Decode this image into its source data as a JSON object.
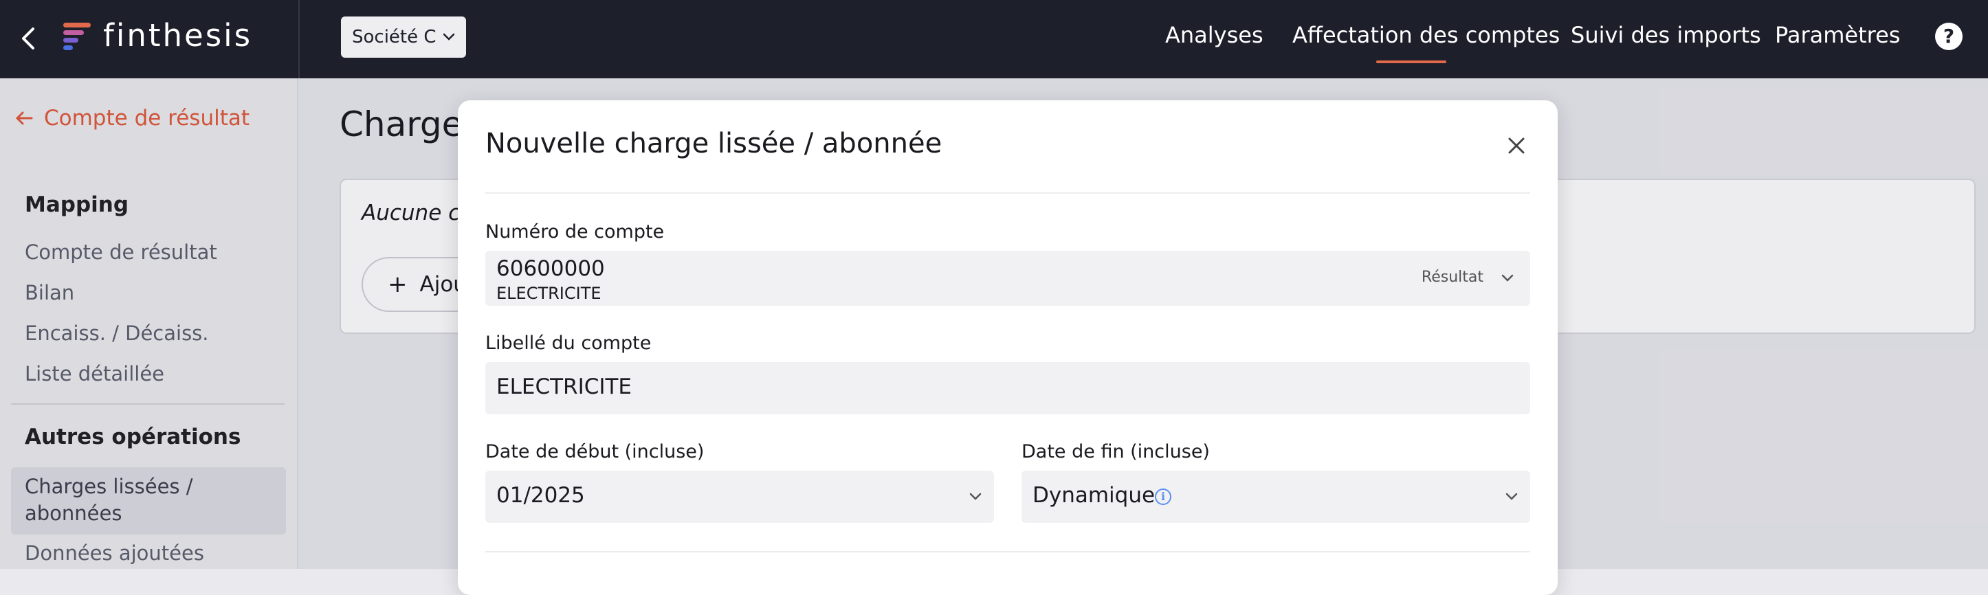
{
  "app": {
    "logo_text": "finthesis"
  },
  "header": {
    "company_select": {
      "value": "Société C"
    },
    "nav": [
      "Analyses",
      "Affectation des comptes",
      "Suivi des imports",
      "Paramètres"
    ],
    "active_nav": "Affectation des comptes",
    "help_label": "?"
  },
  "sidebar": {
    "back_label": "Compte de résultat",
    "sections": [
      {
        "heading": "Mapping",
        "items": [
          "Compte de résultat",
          "Bilan",
          "Encaiss. / Décaiss.",
          "Liste détaillée"
        ]
      },
      {
        "heading": "Autres opérations",
        "items": [
          "Charges lissées / abonnées",
          "Données ajoutées"
        ]
      }
    ],
    "active_item": "Charges lissées / abonnées"
  },
  "main": {
    "title": "Charges",
    "empty_text": "Aucune ch",
    "add_button_label": "Ajou"
  },
  "modal": {
    "title": "Nouvelle charge lissée / abonnée",
    "account_number": {
      "label": "Numéro de compte",
      "value": "60600000",
      "sub_value": "ELECTRICITE",
      "type": "Résultat"
    },
    "account_label": {
      "label": "Libellé du compte",
      "value": "ELECTRICITE"
    },
    "start_date": {
      "label": "Date de début (incluse)",
      "value": "01/2025"
    },
    "end_date": {
      "label": "Date de fin (incluse)",
      "value": "Dynamique",
      "info_icon": "i"
    }
  },
  "colors": {
    "topbar": "#1d1f2b",
    "accent": "#e05a3a",
    "info": "#5b8ff0"
  }
}
